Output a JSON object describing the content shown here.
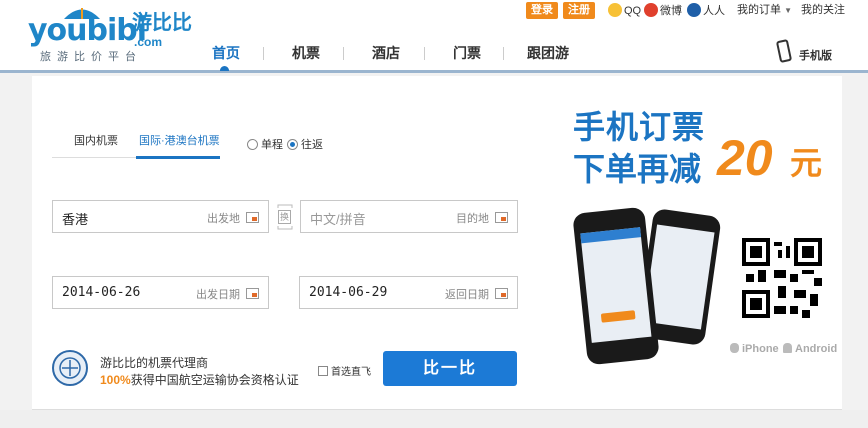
{
  "header": {
    "logo_text": "youbibi",
    "logo_brand": "游比比",
    "logo_domain": ".com",
    "logo_tagline": "旅游比价平台",
    "login_label": "登录",
    "register_label": "注册",
    "qq_label": "QQ",
    "weibo_label": "微博",
    "renren_label": "人人",
    "my_orders_label": "我的订单",
    "my_following_label": "我的关注",
    "mobile_label": "手机版"
  },
  "nav": {
    "items": [
      {
        "label": "首页",
        "active": true
      },
      {
        "label": "机票",
        "active": false
      },
      {
        "label": "酒店",
        "active": false
      },
      {
        "label": "门票",
        "active": false
      },
      {
        "label": "跟团游",
        "active": false
      }
    ]
  },
  "search": {
    "tabs": [
      {
        "label": "国内机票",
        "active": false
      },
      {
        "label": "国际·港澳台机票",
        "active": true
      }
    ],
    "trip_types": [
      {
        "label": "单程",
        "selected": false
      },
      {
        "label": "往返",
        "selected": true
      }
    ],
    "from_value": "香港",
    "from_label": "出发地",
    "to_placeholder": "中文/拼音",
    "to_label": "目的地",
    "swap_label": "换",
    "depart_date": "2014-06-26",
    "depart_label": "出发日期",
    "return_date": "2014-06-29",
    "return_label": "返回日期",
    "direct_only_label": "首选直飞",
    "direct_only_checked": false,
    "submit_label": "比一比"
  },
  "agent": {
    "line1": "游比比的机票代理商",
    "line2_pct": "100%",
    "line2_rest": "获得中国航空运输协会资格认证"
  },
  "promo": {
    "line1": "手机订票",
    "line2": "下单再减",
    "amount": "20",
    "unit": "元",
    "platforms": [
      "iPhone",
      "Android"
    ],
    "accent": "#1b74c2",
    "highlight": "#f08a1c"
  }
}
